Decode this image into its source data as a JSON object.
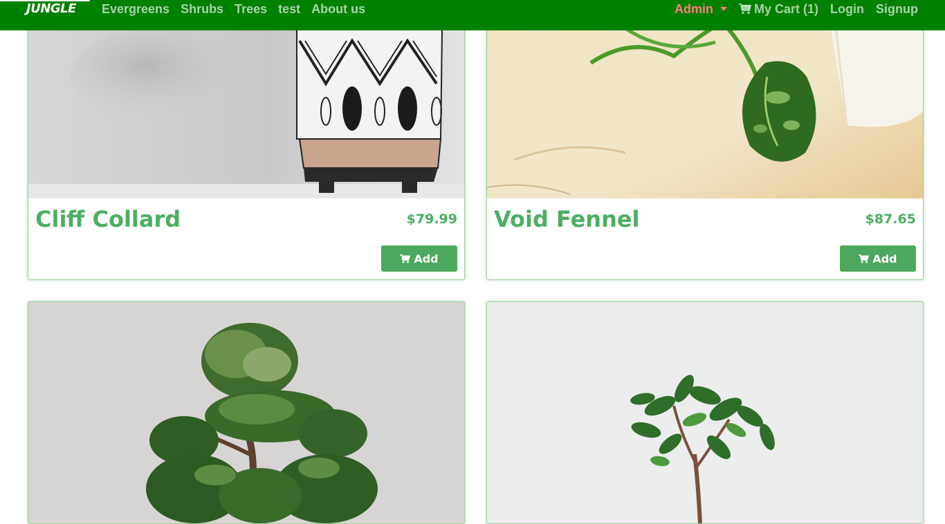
{
  "nav": {
    "brand": "JUNGLE",
    "left_links": [
      {
        "label": "Evergreens"
      },
      {
        "label": "Shrubs"
      },
      {
        "label": "Trees"
      },
      {
        "label": "test"
      },
      {
        "label": "About us"
      }
    ],
    "admin_label": "Admin",
    "cart_label": "My Cart (1)",
    "login_label": "Login",
    "signup_label": "Signup",
    "icons": [
      "caret-down-icon",
      "cart-icon"
    ]
  },
  "products": [
    {
      "name": "Cliff Collard",
      "price": "$79.99",
      "add_label": "Add",
      "image": "patterned-pot-photo"
    },
    {
      "name": "Void Fennel",
      "price": "$87.65",
      "add_label": "Add",
      "image": "pothos-plant-photo"
    },
    {
      "image": "bonsai-tree-photo"
    },
    {
      "image": "small-ficus-photo"
    }
  ],
  "colors": {
    "navbar": "#008000",
    "accent_green": "#4caf62",
    "button_green": "#4ca85c",
    "admin_red": "#ff7f7f"
  }
}
